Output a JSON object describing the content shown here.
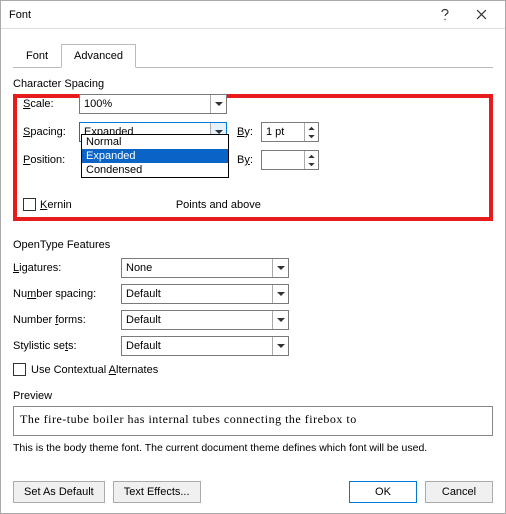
{
  "window": {
    "title": "Font"
  },
  "tabs": {
    "font": "Font",
    "advanced": "Advanced"
  },
  "charspacing": {
    "heading": "Character Spacing",
    "scale_label": "Scale:",
    "scale_value": "100%",
    "spacing_label": "Spacing:",
    "spacing_value": "Expanded",
    "spacing_by_label": "By:",
    "spacing_by_value": "1 pt",
    "position_label": "Position:",
    "position_by_label": "By:",
    "position_by_value": "",
    "dropdown_options": [
      "Normal",
      "Expanded",
      "Condensed"
    ],
    "dropdown_selected": "Expanded",
    "kerning_label": "Kerning",
    "kerning_tail": "Points and above"
  },
  "opentype": {
    "heading": "OpenType Features",
    "ligatures_label": "Ligatures:",
    "ligatures_value": "None",
    "numspacing_label": "Number spacing:",
    "numspacing_value": "Default",
    "numforms_label": "Number forms:",
    "numforms_value": "Default",
    "stylistic_label": "Stylistic sets:",
    "stylistic_value": "Default",
    "contextual_label": "Use Contextual Alternates"
  },
  "preview": {
    "label": "Preview",
    "text": "The fire-tube boiler has internal tubes connecting the firebox to",
    "note": "This is the body theme font. The current document theme defines which font will be used."
  },
  "buttons": {
    "set_default": "Set As Default",
    "text_effects": "Text Effects...",
    "ok": "OK",
    "cancel": "Cancel"
  }
}
